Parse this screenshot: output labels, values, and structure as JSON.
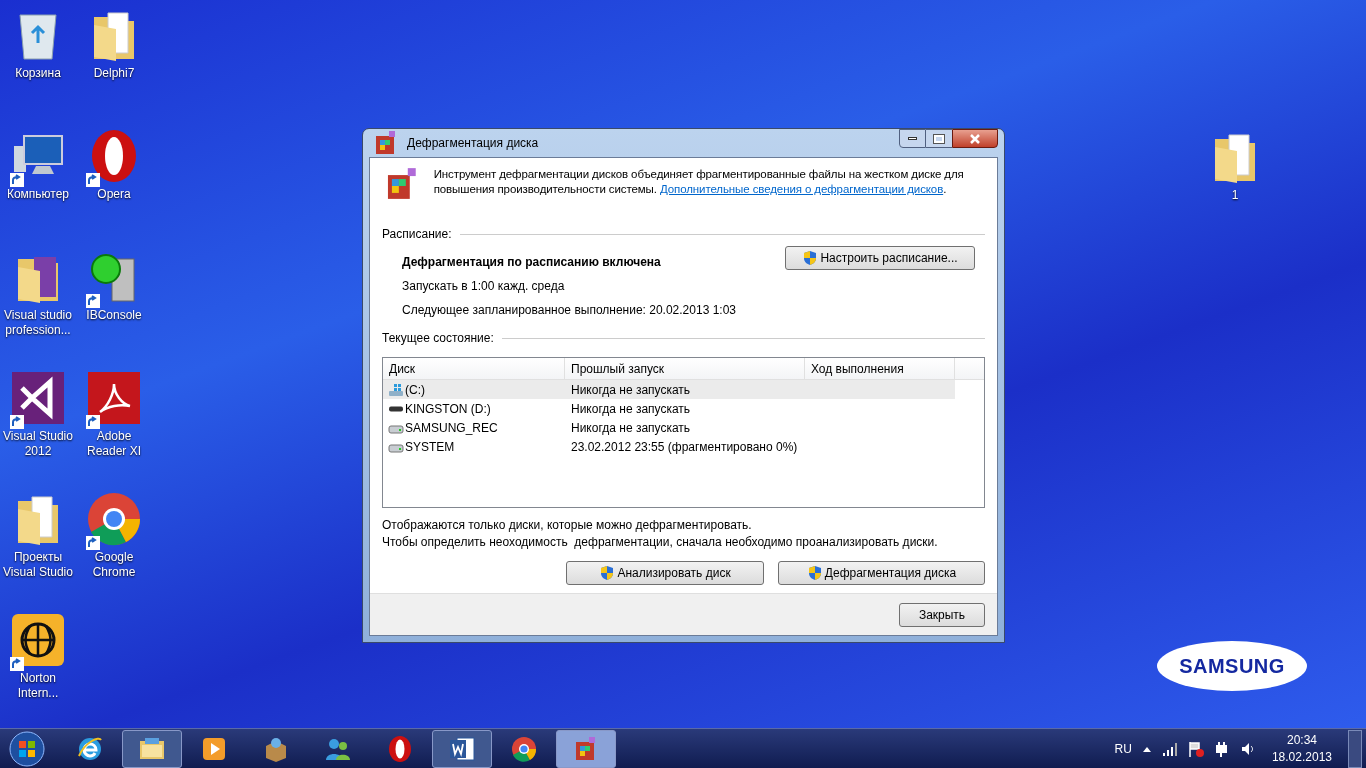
{
  "desktop_icons": [
    {
      "label": "Корзина",
      "kind": "recycle",
      "shortcut": false
    },
    {
      "label": "Delphi7",
      "kind": "folder",
      "shortcut": false
    },
    {
      "label": "Компьютер",
      "kind": "computer",
      "shortcut": true
    },
    {
      "label": "Opera",
      "kind": "opera",
      "shortcut": true
    },
    {
      "label": "Visual studio profession...",
      "kind": "folder-purple",
      "shortcut": false
    },
    {
      "label": "IBConsole",
      "kind": "server",
      "shortcut": true
    },
    {
      "label": "Visual Studio 2012",
      "kind": "vs",
      "shortcut": true
    },
    {
      "label": "Adobe Reader XI",
      "kind": "adobe",
      "shortcut": true
    },
    {
      "label": "Проекты Visual Studio",
      "kind": "folder",
      "shortcut": false
    },
    {
      "label": "Google Chrome",
      "kind": "chrome",
      "shortcut": true
    },
    {
      "label": "Norton Intern...",
      "kind": "globe",
      "shortcut": true
    }
  ],
  "right_icon": {
    "label": "1",
    "kind": "folder",
    "shortcut": false
  },
  "wallpaper_logo": "SAMSUNG",
  "window": {
    "title": "Дефрагментация диска",
    "intro": "Инструмент дефрагментации дисков объединяет фрагментированные файлы на жестком диске для повышения производительности системы.",
    "intro_link": "Дополнительные сведения о дефрагментации дисков",
    "intro_end": ".",
    "schedule_heading": "Расписание:",
    "schedule_status": "Дефрагментация по расписанию включена",
    "schedule_run": "Запускать в 1:00 кажд. среда",
    "schedule_next": "Следующее запланированное выполнение: 20.02.2013 1:03",
    "schedule_button": "Настроить расписание...",
    "state_heading": "Текущее состояние:",
    "columns": [
      "Диск",
      "Прошлый запуск",
      "Ход выполнения"
    ],
    "disks": [
      {
        "name": "(C:)",
        "kind": "system",
        "last_run": "Никогда не запускать",
        "selected": true
      },
      {
        "name": "KINGSTON (D:)",
        "kind": "usb",
        "last_run": "Никогда не запускать",
        "selected": false
      },
      {
        "name": "SAMSUNG_REC",
        "kind": "hdd",
        "last_run": "Никогда не запускать",
        "selected": false
      },
      {
        "name": "SYSTEM",
        "kind": "hdd",
        "last_run": "23.02.2012 23:55 (фрагментировано 0%)",
        "selected": false
      }
    ],
    "notes": [
      "Отображаются только диски, которые можно дефрагментировать.",
      "Чтобы определить неоходимость  дефрагментации, сначала необходимо проанализировать диски."
    ],
    "analyze_button": "Анализировать диск",
    "defrag_button": "Дефрагментация диска",
    "close_button": "Закрыть"
  },
  "taskbar": {
    "items": [
      {
        "kind": "ie",
        "running": false,
        "selected": false
      },
      {
        "kind": "explorer",
        "running": true,
        "selected": false
      },
      {
        "kind": "media",
        "running": false,
        "selected": false
      },
      {
        "kind": "installer",
        "running": false,
        "selected": false
      },
      {
        "kind": "messenger",
        "running": false,
        "selected": false
      },
      {
        "kind": "opera",
        "running": false,
        "selected": false
      },
      {
        "kind": "word",
        "running": true,
        "selected": false
      },
      {
        "kind": "chrome",
        "running": false,
        "selected": false
      },
      {
        "kind": "defrag",
        "running": true,
        "selected": true
      }
    ],
    "language": "RU",
    "time": "20:34",
    "date": "18.02.2013"
  }
}
